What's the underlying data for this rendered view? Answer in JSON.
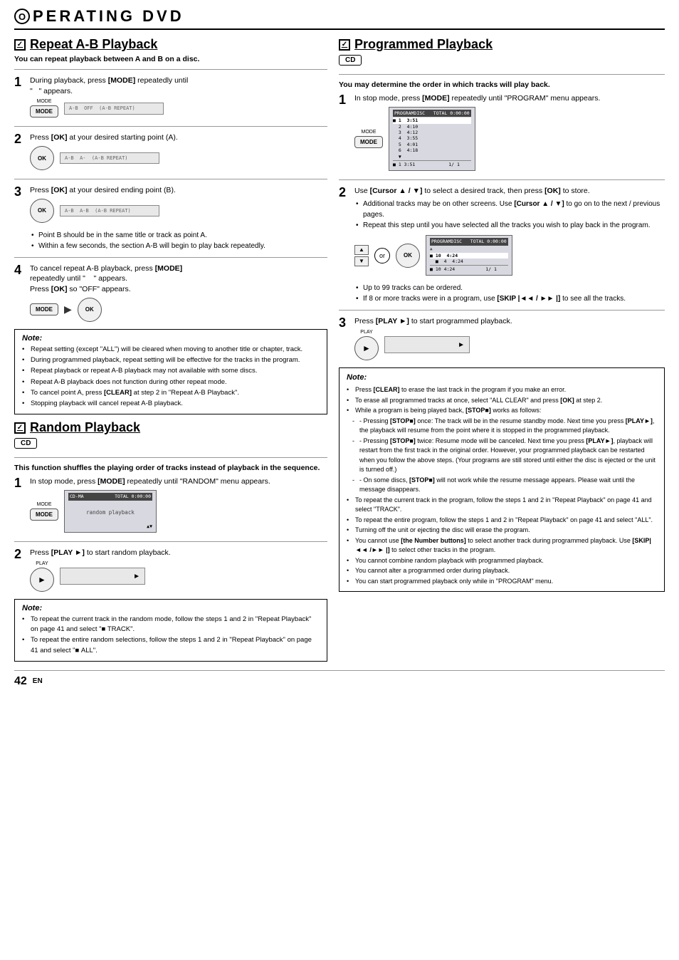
{
  "header": {
    "circle_letter": "O",
    "title": "PERATING   DVD"
  },
  "repeat_ab": {
    "section_title": "Repeat A-B Playback",
    "desc": "You can repeat playback between A and B on a disc.",
    "steps": [
      {
        "num": "1",
        "text": "During playback, press [MODE] repeatedly until \" \" appears.",
        "mode_label": "MODE",
        "screen_text": "OFF  (A-B REPEAT)"
      },
      {
        "num": "2",
        "text": "Press [OK] at your desired starting point (A).",
        "ok_label": "OK",
        "screen_text": "A-  (A-B REPEAT)"
      },
      {
        "num": "3",
        "text": "Press [OK] at your desired ending point (B).",
        "ok_label": "OK",
        "screen_text": "A-B  (A-B REPEAT)"
      }
    ],
    "bullet1": "Point B should be in the same title or track as point A.",
    "bullet2": "Within a few seconds, the section A-B will begin to play back repeatedly.",
    "step4_num": "4",
    "step4_text1": "To cancel repeat A-B playback, press [MODE]",
    "step4_text2": "repeatedly until \"  \" appears.",
    "step4_text3": "Press [OK] so \"OFF\" appears.",
    "mode_label": "MODE",
    "ok_label": "OK",
    "note_title": "Note:",
    "notes": [
      "Repeat setting (except \"ALL\") will be cleared when moving to another title or chapter, track.",
      "During programmed playback, repeat setting will be effective for the tracks in the program.",
      "Repeat playback or repeat A-B playback may not available with some discs.",
      "Repeat A-B playback does not function during other repeat mode.",
      "To cancel point A, press [CLEAR] at step 2 in \"Repeat A-B Playback\".",
      "Stopping playback will cancel repeat A-B playback."
    ]
  },
  "random": {
    "section_title": "Random Playback",
    "cd_badge": "CD",
    "desc": "This function shuffles the playing order of tracks instead of playback in the sequence.",
    "step1_num": "1",
    "step1_text": "In stop mode, press [MODE] repeatedly until \"RANDOM\" menu appears.",
    "mode_label": "MODE",
    "screen_header1": "CD-MA",
    "screen_header2": "TOTAL 0:00:00",
    "screen_row": "random playback",
    "step2_num": "2",
    "step2_text": "Press [PLAY ►] to start random playback.",
    "play_label": "►",
    "note_title": "Note:",
    "notes": [
      "To repeat the current track in the random mode, follow the steps 1 and 2 in \"Repeat Playback\" on page 41 and select \"  TRACK\".",
      "To repeat the entire random selections, follow the steps 1 and 2 in \"Repeat Playback\" on page 41 and select \"  ALL\"."
    ]
  },
  "programmed": {
    "section_title": "Programmed Playback",
    "cd_badge": "CD",
    "desc": "You may determine the order in which tracks will play back.",
    "step1_num": "1",
    "step1_text": "In stop mode, press [MODE] repeatedly until \"PROGRAM\" menu appears.",
    "mode_label": "MODE",
    "ps_header_left": "PROGRAM",
    "ps_header_mid": "DISC",
    "ps_header_right": "TOTAL  0:00:00",
    "ps_rows": [
      {
        "label": "■ 1 3:51",
        "selected": true
      },
      {
        "label": "  2  4:10"
      },
      {
        "label": "  3  4:12"
      },
      {
        "label": "  4  3:55"
      },
      {
        "label": "  5  4:01"
      },
      {
        "label": "  6  4:18"
      },
      {
        "label": "  ▼"
      }
    ],
    "ps_bottom": "■ 1 3:51         1/ 1",
    "step2_num": "2",
    "step2_text1": "Use [Cursor ▲ / ▼] to select a desired track, then press [OK] to store.",
    "step2_bullet1": "Additional tracks may be on other screens. Use [Cursor ▲ / ▼] to go on to the next / previous pages.",
    "step2_bullet2": "Repeat this step until you have selected all the tracks you wish to play back in the program.",
    "ps2_rows": [
      {
        "label": "■ 10 4:24",
        "selected": true
      },
      {
        "label": "■ 4  4:24"
      }
    ],
    "ps2_bottom": "■ 10 4:24        1/ 1",
    "or_label": "or",
    "ok_label": "OK",
    "bullets_bottom": [
      "Up to 99 tracks can be ordered.",
      "If 8 or more tracks were in a program, use [SKIP |◄◄ / ►► |] to see all the tracks."
    ],
    "step3_num": "3",
    "step3_text": "Press [PLAY ►] to start programmed playback.",
    "play_label": "PLAY",
    "play_icon": "►",
    "note_title": "Note:",
    "notes": [
      "Press [CLEAR] to erase the last track in the program if you make an error.",
      "To erase all programmed tracks at once, select \"ALL CLEAR\" and press [OK] at step 2.",
      "While a program is being played back, [STOP■] works as follows:",
      "- Pressing [STOP■] once: The track will be in the resume standby mode. Next time you press [PLAY►], the playback will resume from the point where it is stopped in the programmed playback.",
      "- Pressing [STOP■] twice: Resume mode will be canceled. Next time you press [PLAY►], playback will restart from the first track in the original order. However, your programmed playback can be restarted when you follow the above steps. (Your programs are still stored until either the disc is ejected or the unit is turned off.)",
      "- On some discs, [STOP■] will not work while the resume message appears. Please wait until the message disappears.",
      "To repeat the current track in the program, follow the steps 1 and 2 in \"Repeat Playback\" on page 41 and select \"TRACK\".",
      "To repeat the entire program, follow the steps 1 and 2 in \"Repeat Playback\" on page 41 and select \"ALL\".",
      "Turning off the unit or ejecting the disc will erase the program.",
      "You cannot use [the Number buttons] to select another track during programmed playback. Use [SKIP|◄◄ /►► |] to select other tracks in the program.",
      "You cannot combine random playback with programmed playback.",
      "You cannot alter a programmed order during playback.",
      "You can start programmed playback only while in \"PROGRAM\" menu."
    ]
  },
  "footer": {
    "page_number": "42",
    "en_label": "EN"
  }
}
